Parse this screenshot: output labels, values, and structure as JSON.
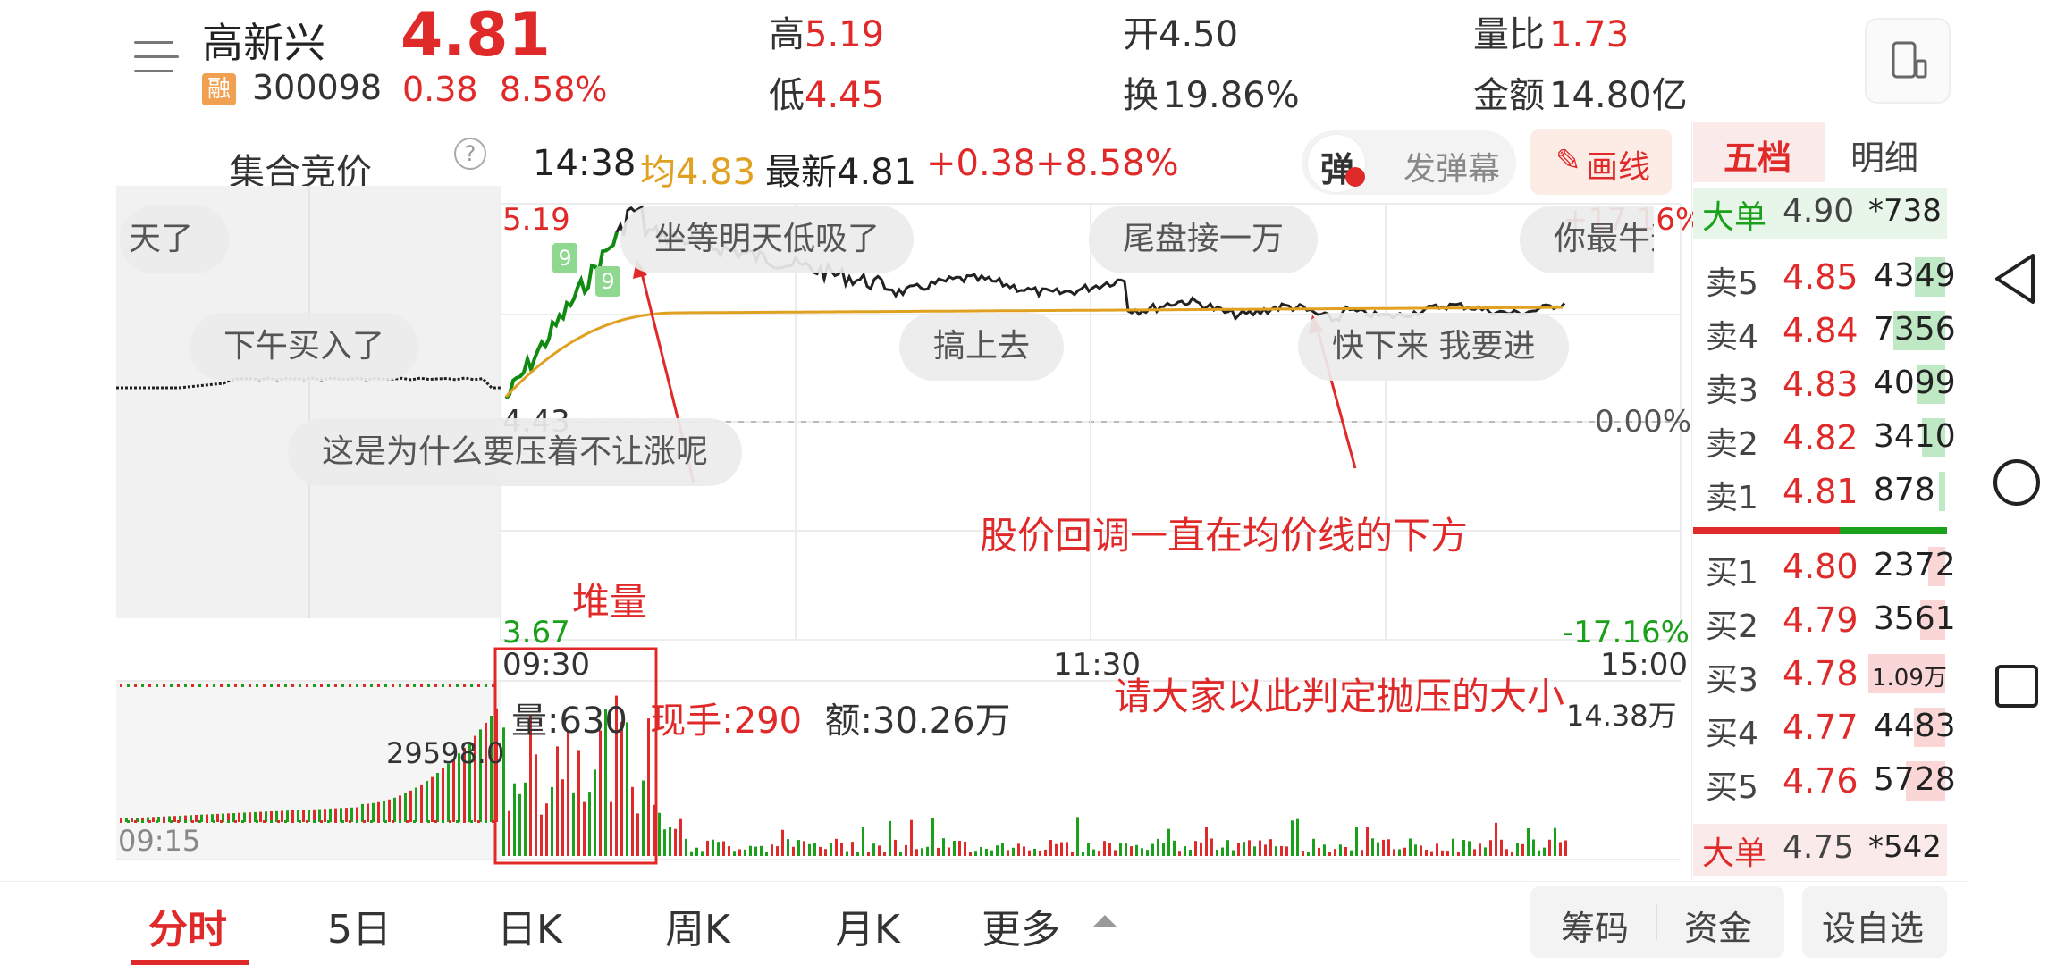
{
  "stock": {
    "name": "高新兴",
    "margin_badge": "融",
    "code": "300098",
    "price": "4.81",
    "change": "0.38",
    "change_pct": "8.58%"
  },
  "stats": {
    "high_label": "高",
    "high_value": "5.19",
    "open_label": "开",
    "open_value": "4.50",
    "vol_ratio_label": "量比",
    "vol_ratio_value": "1.73",
    "low_label": "低",
    "low_value": "4.45",
    "turnover_label": "换",
    "turnover_value": "19.86%",
    "amount_label": "金额",
    "amount_value": "14.80亿"
  },
  "toolbar": {
    "auction_label": "集合竞价",
    "help_icon": "?",
    "time": "14:38",
    "avg_label": "均4.83",
    "latest_label": "最新4.81",
    "change": "+0.38",
    "change_pct": "+8.58%",
    "danmu_icon_text": "弹",
    "send_danmu": "发弹幕",
    "draw_line": "画线"
  },
  "chart": {
    "price_high_label": "5.19",
    "price_low_label": "4.43",
    "pct_top": "+17.16%",
    "pct_mid": "0.00%",
    "pct_bottom": "-17.16%",
    "bottom_price": "3.67",
    "time_start": "09:30",
    "time_mid": "11:30",
    "time_end": "15:00",
    "pre_time": "09:15",
    "volume_max": "14.38万",
    "auction_volume": "29598.0",
    "volume_info": {
      "vol": "量:630",
      "hand": "现手:290",
      "amount": "额:30.26万"
    },
    "marker_9": "9",
    "colors": {
      "price_line": "#222222",
      "avg_line": "#e0a020",
      "up": "#e02a2a",
      "down": "#1aa01a"
    }
  },
  "danmaku": [
    "天了",
    "坐等明天低吸了",
    "尾盘接一万",
    "你最牛逼",
    "下午买入了",
    "搞上去",
    "快下来 我要进",
    "这是为什么要压着不让涨呢"
  ],
  "annotations": {
    "below_avg": "股价回调一直在均价线的下方",
    "pile_volume": "堆量",
    "judge_pressure": "请大家以此判定抛压的大小"
  },
  "orderbook": {
    "tab_five": "五档",
    "tab_detail": "明细",
    "big_top": {
      "label": "大单",
      "price": "4.90",
      "vol": "*738"
    },
    "asks": [
      {
        "label": "卖5",
        "price": "4.85",
        "vol": "4349",
        "fill": 0.28
      },
      {
        "label": "卖4",
        "price": "4.84",
        "vol": "7356",
        "fill": 0.48
      },
      {
        "label": "卖3",
        "price": "4.83",
        "vol": "4099",
        "fill": 0.27
      },
      {
        "label": "卖2",
        "price": "4.82",
        "vol": "3410",
        "fill": 0.22
      },
      {
        "label": "卖1",
        "price": "4.81",
        "vol": "878",
        "fill": 0.06
      }
    ],
    "bids": [
      {
        "label": "买1",
        "price": "4.80",
        "vol": "2372",
        "fill": 0.16
      },
      {
        "label": "买2",
        "price": "4.79",
        "vol": "3561",
        "fill": 0.23
      },
      {
        "label": "买3",
        "price": "4.78",
        "vol": "1.09万",
        "fill": 0.72
      },
      {
        "label": "买4",
        "price": "4.77",
        "vol": "4483",
        "fill": 0.29
      },
      {
        "label": "买5",
        "price": "4.76",
        "vol": "5728",
        "fill": 0.37
      }
    ],
    "big_bottom": {
      "label": "大单",
      "price": "4.75",
      "vol": "*542"
    }
  },
  "tabs": [
    "分时",
    "5日",
    "日K",
    "周K",
    "月K",
    "更多"
  ],
  "bottom_buttons": {
    "chips": "筹码",
    "funds": "资金",
    "add_watch": "设自选"
  }
}
